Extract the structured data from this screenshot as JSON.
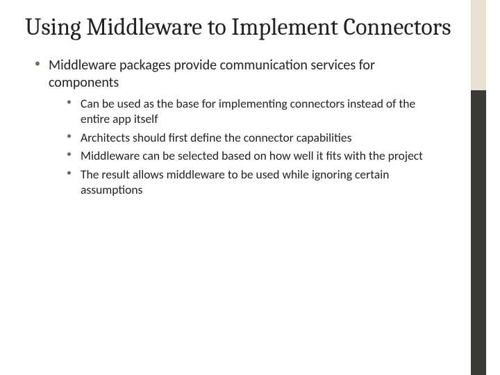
{
  "slide": {
    "title": "Using Middleware to Implement Connectors",
    "bullets": [
      {
        "text": "Middleware packages provide communication services for components",
        "children": [
          "Can be used as the base for implementing connectors instead of the entire app itself",
          "Architects should first define the connector capabilities",
          "Middleware can be selected based on how well it fits with the project",
          "The result allows middleware to be used while ignoring certain assumptions"
        ]
      }
    ]
  }
}
